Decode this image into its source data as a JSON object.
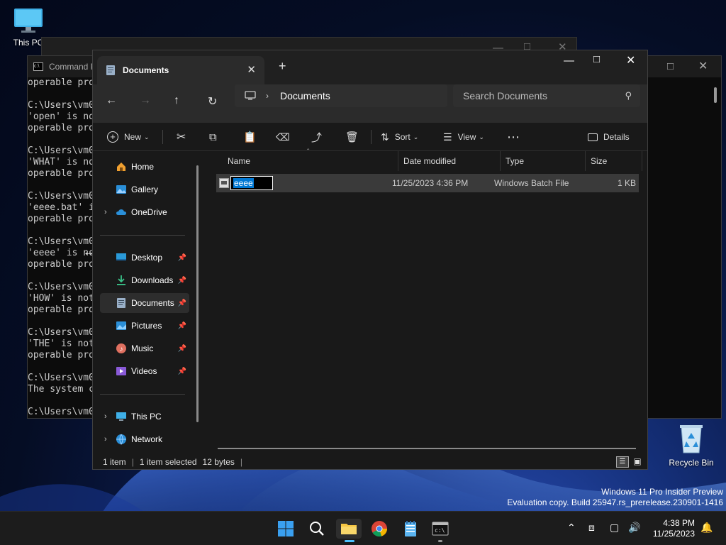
{
  "desktop": {
    "icons": [
      {
        "label": "This PC"
      },
      {
        "label": "Recycle Bin"
      }
    ],
    "watermark": {
      "line1": "Windows 11 Pro Insider Preview",
      "line2": "Evaluation copy. Build 25947.rs_prerelease.230901-1416"
    }
  },
  "cmd_window": {
    "title": "Command P",
    "lines": [
      "operable pro",
      "",
      "C:\\Users\\vm0",
      "'open' is no",
      "operable pro",
      "",
      "C:\\Users\\vm0",
      "'WHAT' is no",
      "operable pro",
      "",
      "C:\\Users\\vm0",
      "'eeee.bat' i",
      "operable pro",
      "",
      "C:\\Users\\vm0",
      "'eeee' is no",
      "operable pro",
      "",
      "C:\\Users\\vm0",
      "'HOW' is not",
      "operable pro",
      "",
      "C:\\Users\\vm0",
      "'THE' is not",
      "operable pro",
      "",
      "C:\\Users\\vm0",
      "The system c",
      "",
      "C:\\Users\\vm0"
    ]
  },
  "explorer": {
    "tab_title": "Documents",
    "breadcrumb": [
      "Documents"
    ],
    "search_placeholder": "Search Documents",
    "toolbar": {
      "new": "New",
      "sort": "Sort",
      "view": "View",
      "details": "Details"
    },
    "sidebar": {
      "home": "Home",
      "gallery": "Gallery",
      "onedrive": "OneDrive",
      "desktop": "Desktop",
      "downloads": "Downloads",
      "documents": "Documents",
      "pictures": "Pictures",
      "music": "Music",
      "videos": "Videos",
      "thispc": "This PC",
      "network": "Network"
    },
    "columns": {
      "name": "Name",
      "date": "Date modified",
      "type": "Type",
      "size": "Size"
    },
    "files": [
      {
        "name": "eeee",
        "date": "11/25/2023 4:36 PM",
        "type": "Windows Batch File",
        "size": "1 KB"
      }
    ],
    "status": {
      "items": "1 item",
      "selected": "1 item selected",
      "size": "12 bytes"
    }
  },
  "taskbar": {
    "time": "4:38 PM",
    "date": "11/25/2023"
  },
  "colors": {
    "accent": "#0078d4",
    "explorer_bg": "#191919",
    "selected_row": "#3a3a3a"
  }
}
